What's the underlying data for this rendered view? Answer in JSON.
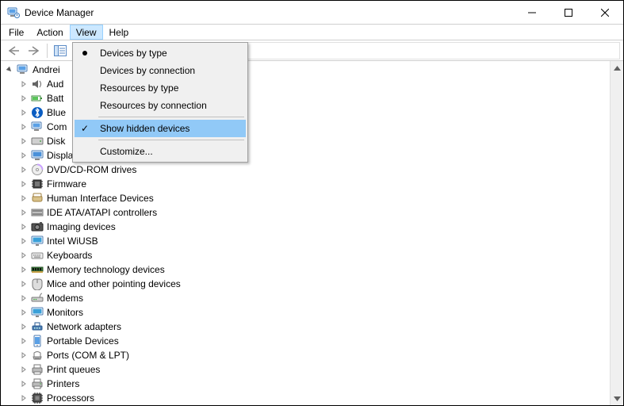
{
  "window": {
    "title": "Device Manager"
  },
  "menubar": {
    "items": [
      "File",
      "Action",
      "View",
      "Help"
    ],
    "active_index": 2
  },
  "dropdown": {
    "items": [
      {
        "label": "Devices by type",
        "mark": "bullet"
      },
      {
        "label": "Devices by connection",
        "mark": ""
      },
      {
        "label": "Resources by type",
        "mark": ""
      },
      {
        "label": "Resources by connection",
        "mark": ""
      }
    ],
    "items2": [
      {
        "label": "Show hidden devices",
        "mark": "check",
        "hover": true
      }
    ],
    "items3": [
      {
        "label": "Customize...",
        "mark": ""
      }
    ]
  },
  "tree": {
    "root": {
      "label": "Andrei",
      "icon": "computer"
    },
    "children": [
      {
        "label": "Aud",
        "icon": "audio"
      },
      {
        "label": "Batt",
        "icon": "battery"
      },
      {
        "label": "Blue",
        "icon": "bluetooth"
      },
      {
        "label": "Com",
        "icon": "computer"
      },
      {
        "label": "Disk",
        "icon": "disk"
      },
      {
        "label": "Display",
        "icon": "display"
      },
      {
        "label": "DVD/CD-ROM drives",
        "icon": "dvd"
      },
      {
        "label": "Firmware",
        "icon": "firmware"
      },
      {
        "label": "Human Interface Devices",
        "icon": "hid"
      },
      {
        "label": "IDE ATA/ATAPI controllers",
        "icon": "ide"
      },
      {
        "label": "Imaging devices",
        "icon": "imaging"
      },
      {
        "label": "Intel WiUSB",
        "icon": "monitor"
      },
      {
        "label": "Keyboards",
        "icon": "keyboard"
      },
      {
        "label": "Memory technology devices",
        "icon": "memory"
      },
      {
        "label": "Mice and other pointing devices",
        "icon": "mouse"
      },
      {
        "label": "Modems",
        "icon": "modem"
      },
      {
        "label": "Monitors",
        "icon": "monitor"
      },
      {
        "label": "Network adapters",
        "icon": "network"
      },
      {
        "label": "Portable Devices",
        "icon": "portable"
      },
      {
        "label": "Ports (COM & LPT)",
        "icon": "ports"
      },
      {
        "label": "Print queues",
        "icon": "printqueue"
      },
      {
        "label": "Printers",
        "icon": "printer"
      },
      {
        "label": "Processors",
        "icon": "processor"
      }
    ]
  }
}
